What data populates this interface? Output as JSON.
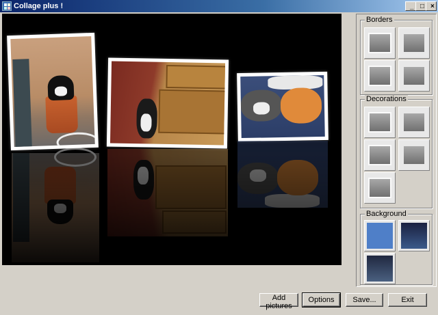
{
  "window": {
    "title": "Collage plus !"
  },
  "title_buttons": {
    "minimize": "_",
    "maximize": "□",
    "close": "×"
  },
  "icons": {
    "app": "app-collage-icon"
  },
  "groups": {
    "borders": "Borders",
    "decorations": "Decorations",
    "background": "Background"
  },
  "buttons": {
    "add_pictures": "Add pictures",
    "options": "Options",
    "save": "Save...",
    "exit": "Exit"
  },
  "colors": {
    "titlebar_start": "#0a246a",
    "window_face": "#d4d0c8",
    "canvas": "#000000",
    "background_blue": "#4f7fc8"
  }
}
